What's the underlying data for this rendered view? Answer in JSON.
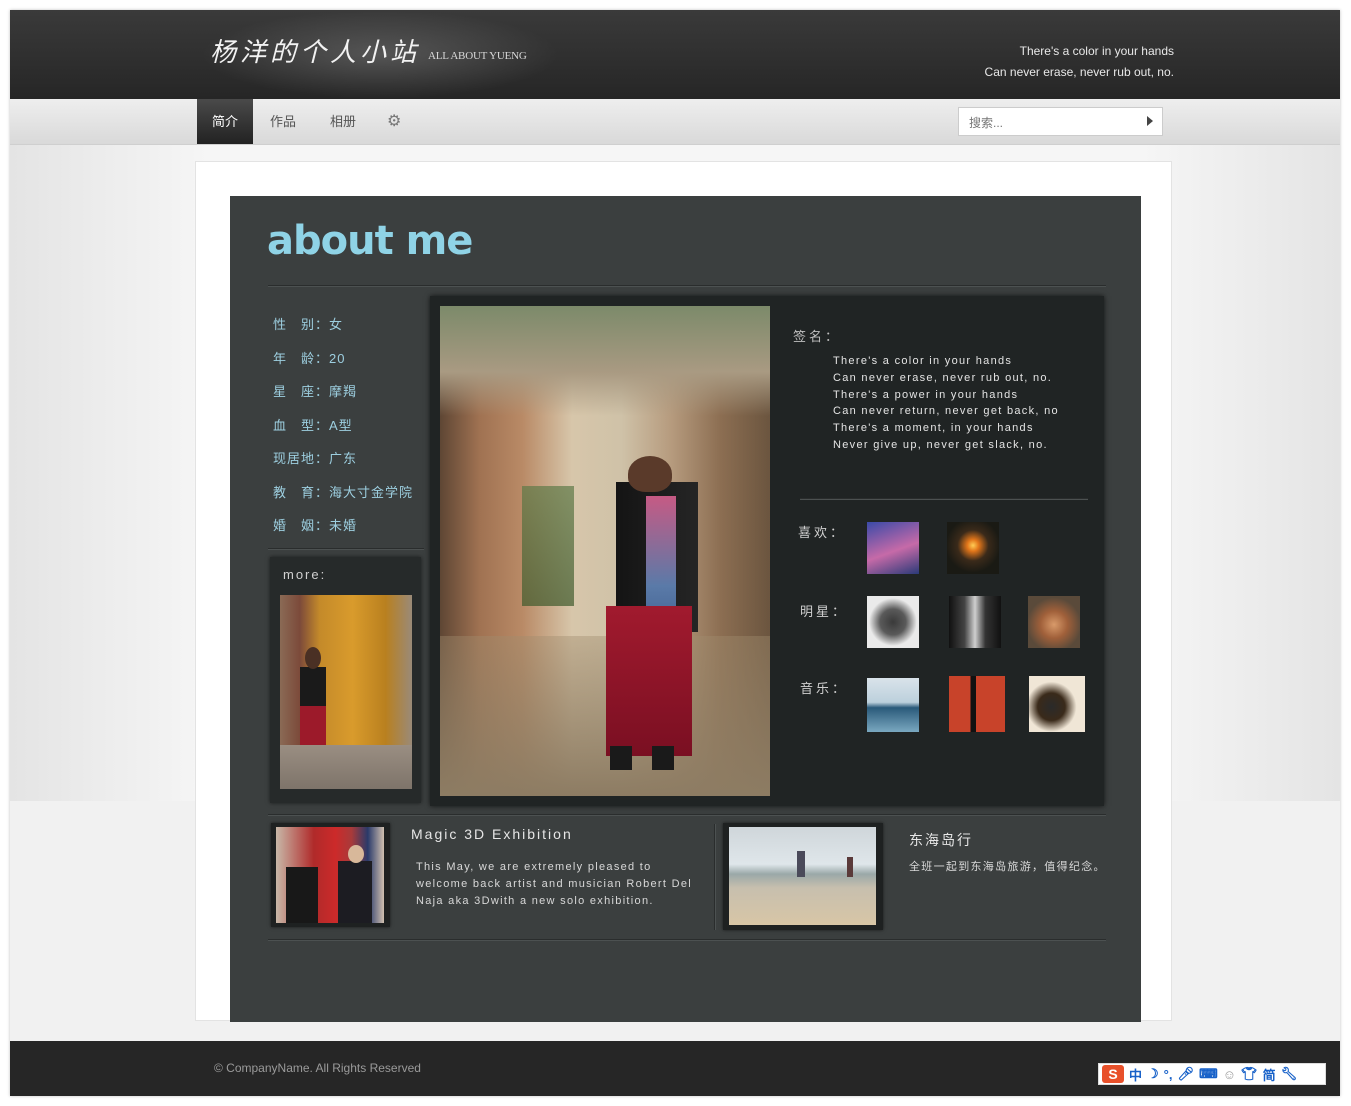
{
  "header": {
    "logo": "杨洋的个人小站",
    "logo_sub": "ALL ABOUT YUENG",
    "tagline_1": "There's a color in your hands",
    "tagline_2": "Can never erase, never rub out, no."
  },
  "nav": {
    "items": [
      {
        "label": "简介"
      },
      {
        "label": "作品"
      },
      {
        "label": "相册"
      }
    ],
    "settings_icon": "gear-icon"
  },
  "search": {
    "placeholder": "搜索..."
  },
  "about": {
    "title": "about me",
    "profile": [
      {
        "text": "性　别：女"
      },
      {
        "text": "年　龄：20"
      },
      {
        "text": "星　座：摩羯"
      },
      {
        "text": "血　型：A型"
      },
      {
        "text": "现居地：广东"
      },
      {
        "text": "教　育：海大寸金学院"
      },
      {
        "text": "婚　姻：未婚"
      }
    ],
    "more_label": "more:",
    "signature_label": "签名：",
    "signature_lines": [
      "There's a color in your hands",
      "Can never erase, never rub out, no.",
      "There's a power in your hands",
      "Can never return, never get back, no",
      "There's a moment, in your hands",
      "Never give up, never get slack, no."
    ],
    "likes_label": "喜欢：",
    "stars_label": "明星：",
    "music_label": "音乐："
  },
  "news": [
    {
      "title": "Magic 3D Exhibition",
      "body": "This May, we are extremely pleased to welcome back artist and musician Robert Del Naja aka 3Dwith a new solo exhibition."
    },
    {
      "title": "东海岛行",
      "body": "全班一起到东海岛旅游，值得纪念。"
    }
  ],
  "footer": {
    "copyright": "© CompanyName. All Rights Reserved"
  },
  "ime": {
    "chars": [
      "中",
      "简"
    ]
  }
}
